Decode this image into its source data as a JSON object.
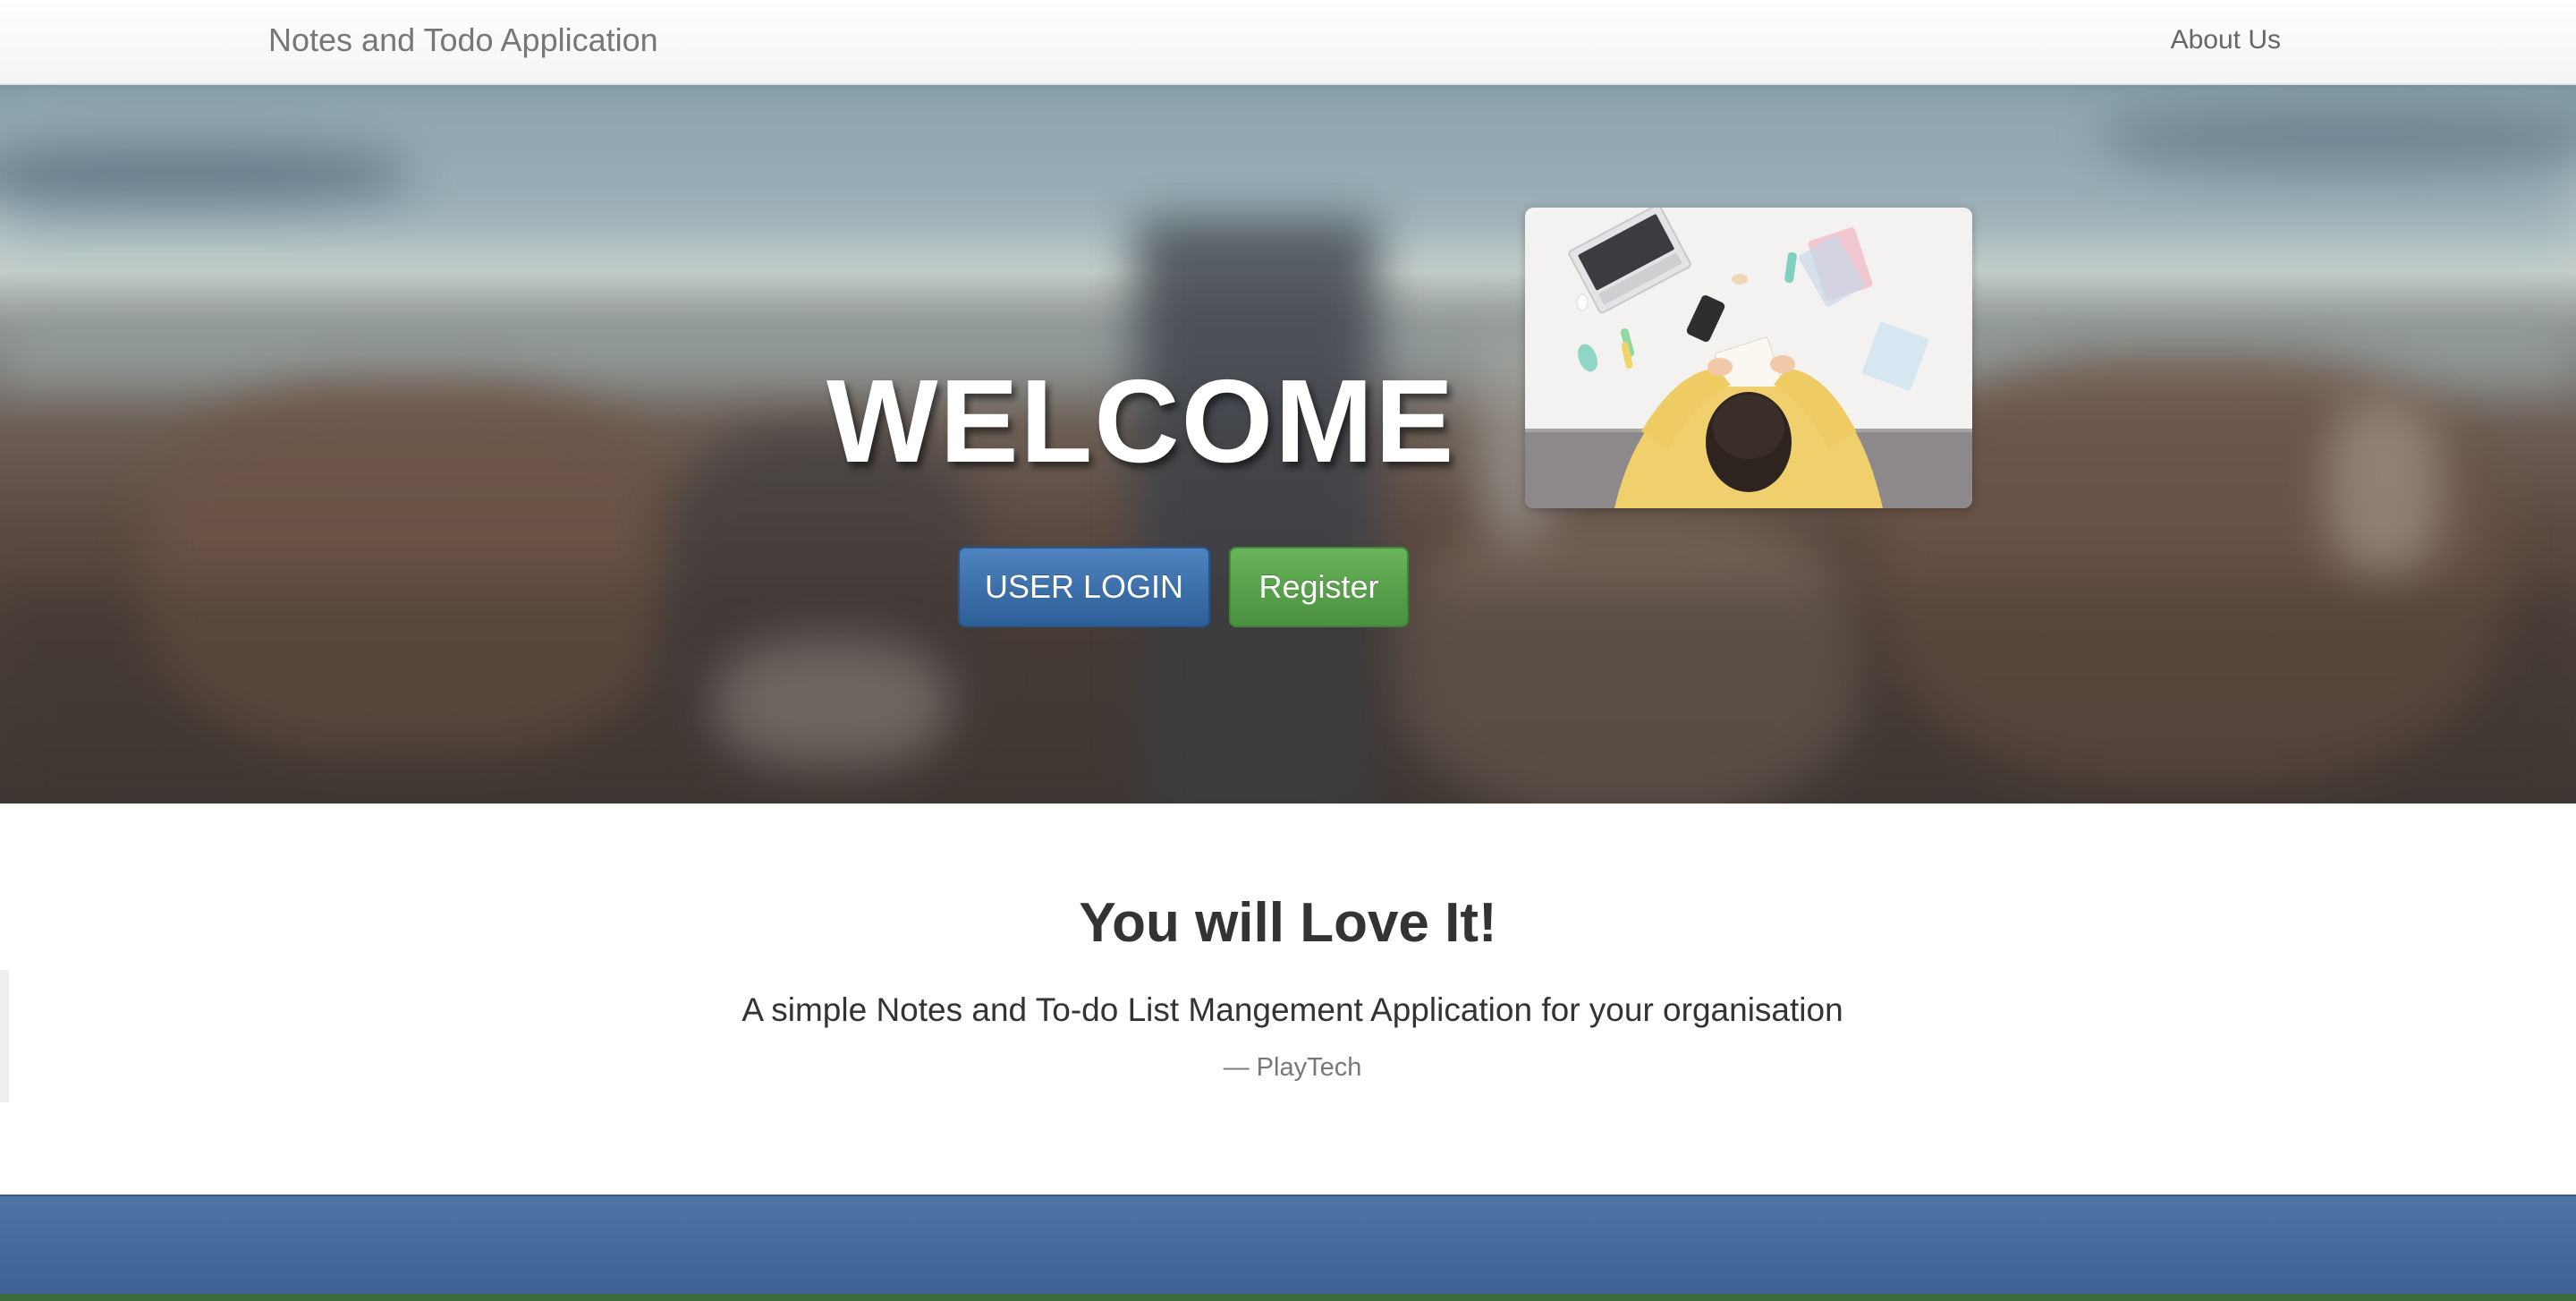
{
  "navbar": {
    "brand": "Notes and Todo Application",
    "about_link": "About Us"
  },
  "hero": {
    "heading": "WELCOME",
    "login_button": "USER LOGIN",
    "register_button": "Register"
  },
  "quote": {
    "title": "You will Love It!",
    "text": "A simple Notes and To-do List Mangement Application for your organisation",
    "author": "— PlayTech"
  },
  "colors": {
    "primary": "#337ab7",
    "success": "#5cb85c",
    "footer": "#3e6196"
  }
}
